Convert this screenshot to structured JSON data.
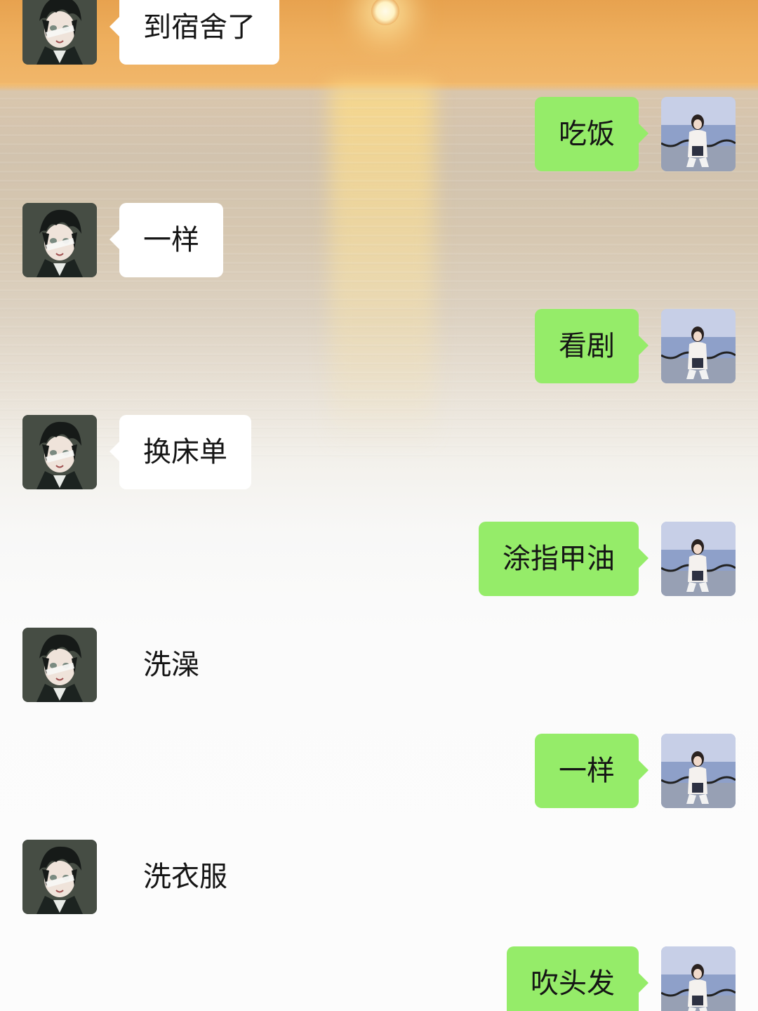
{
  "colors": {
    "self_bubble": "#95ec69",
    "other_bubble": "#ffffff",
    "text": "#151515"
  },
  "avatars": {
    "other": "anime-boy-avatar",
    "self": "girl-photo-avatar"
  },
  "messages": [
    {
      "sender": "other",
      "text": "到宿舍了",
      "bubble": "white"
    },
    {
      "sender": "self",
      "text": "吃饭"
    },
    {
      "sender": "other",
      "text": "一样",
      "bubble": "white"
    },
    {
      "sender": "self",
      "text": "看剧"
    },
    {
      "sender": "other",
      "text": "换床单",
      "bubble": "white"
    },
    {
      "sender": "self",
      "text": "涂指甲油"
    },
    {
      "sender": "other",
      "text": "洗澡",
      "bubble": "plain"
    },
    {
      "sender": "self",
      "text": "一样"
    },
    {
      "sender": "other",
      "text": "洗衣服",
      "bubble": "plain"
    },
    {
      "sender": "self",
      "text": "吹头发"
    }
  ]
}
